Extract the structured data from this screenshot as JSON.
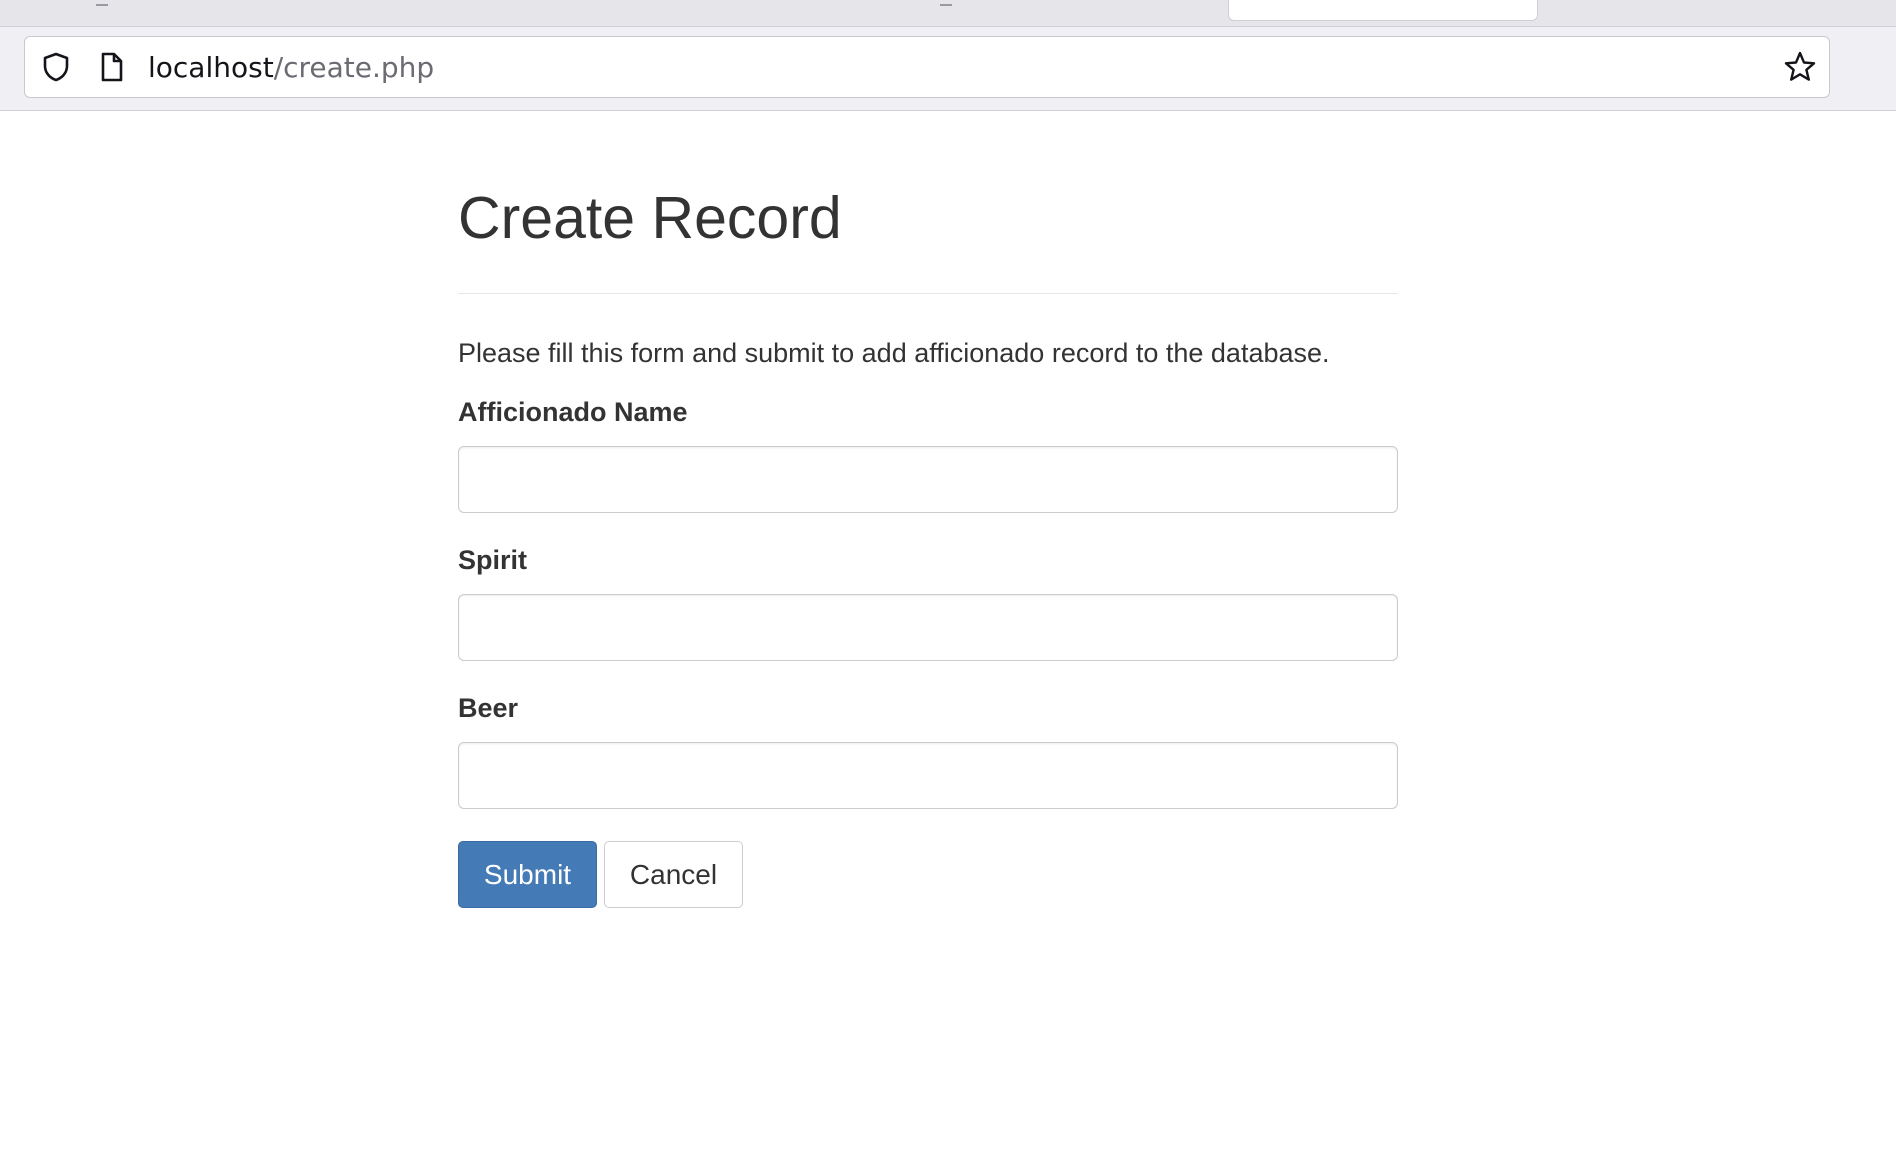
{
  "browser": {
    "url_host": "localhost",
    "url_path": "/create.php"
  },
  "icons": {
    "shield": "shield-icon",
    "page": "page-icon",
    "bookmark": "star-icon"
  },
  "page": {
    "title": "Create Record",
    "intro": "Please fill this form and submit to add afficionado record to the database."
  },
  "form": {
    "fields": [
      {
        "label": "Afficionado Name",
        "value": ""
      },
      {
        "label": "Spirit",
        "value": ""
      },
      {
        "label": "Beer",
        "value": ""
      }
    ],
    "submit_label": "Submit",
    "cancel_label": "Cancel"
  },
  "colors": {
    "primary": "#447ab5",
    "text": "#333333"
  }
}
